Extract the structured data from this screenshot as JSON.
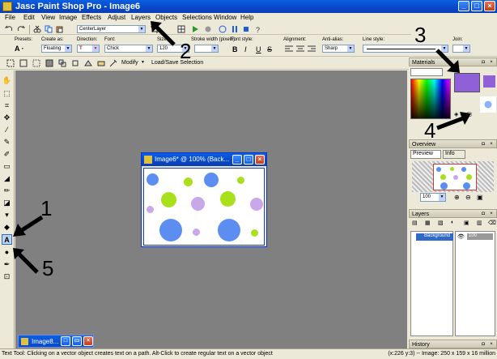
{
  "window": {
    "title": "Jasc Paint Shop Pro - Image6"
  },
  "menu": [
    "File",
    "Edit",
    "View",
    "Image",
    "Effects",
    "Adjust",
    "Layers",
    "Objects",
    "Selections",
    "Window",
    "Help"
  ],
  "toolbar": {
    "layer_combo": "CenterLayer"
  },
  "tool_options": {
    "presets_label": "Presets:",
    "create_as_label": "Create as:",
    "create_as_value": "Floating",
    "direction_label": "Direction:",
    "font_label": "Font:",
    "font_value": "Chick",
    "size_label": "Size:",
    "size_value": "120",
    "stroke_width_label": "Stroke width (pixels):",
    "font_style_label": "Font style:",
    "alignment_label": "Alignment:",
    "anti_alias_label": "Anti-alias:",
    "anti_alias_value": "Sharp",
    "line_style_label": "Line style:",
    "join_label": "Join:",
    "bold": "B",
    "italic": "I",
    "underline": "U",
    "strike": "S"
  },
  "toolbar2": {
    "modify_label": "Modify",
    "load_save_label": "Load/Save Selection"
  },
  "document": {
    "title": "Image6* @ 100% (Back...",
    "minimized_title": "Image8..."
  },
  "panels": {
    "materials_title": "Materials",
    "overview_title": "Overview",
    "preview_tab": "Preview",
    "info_tab": "Info",
    "zoom_value": "100",
    "layers_title": "Layers",
    "layer_name": "Background",
    "layer_opacity": "100",
    "history_title": "History"
  },
  "statusbar": {
    "left": "Text Tool: Clicking on a vector object creates text on a path. Alt-Click to create regular text on a vector object",
    "right": "(x:226 y:3) -- Image: 250 x 159 x 16 million"
  },
  "annotations": [
    "1",
    "2",
    "3",
    "4",
    "5"
  ],
  "colors": {
    "titlebar": "#0848c8",
    "workspace": "#808080",
    "dot_blue": "#5b8ef0",
    "dot_green": "#a8e01c",
    "dot_lavender": "#c8a8e8",
    "material_swatch": "#9060d8"
  }
}
